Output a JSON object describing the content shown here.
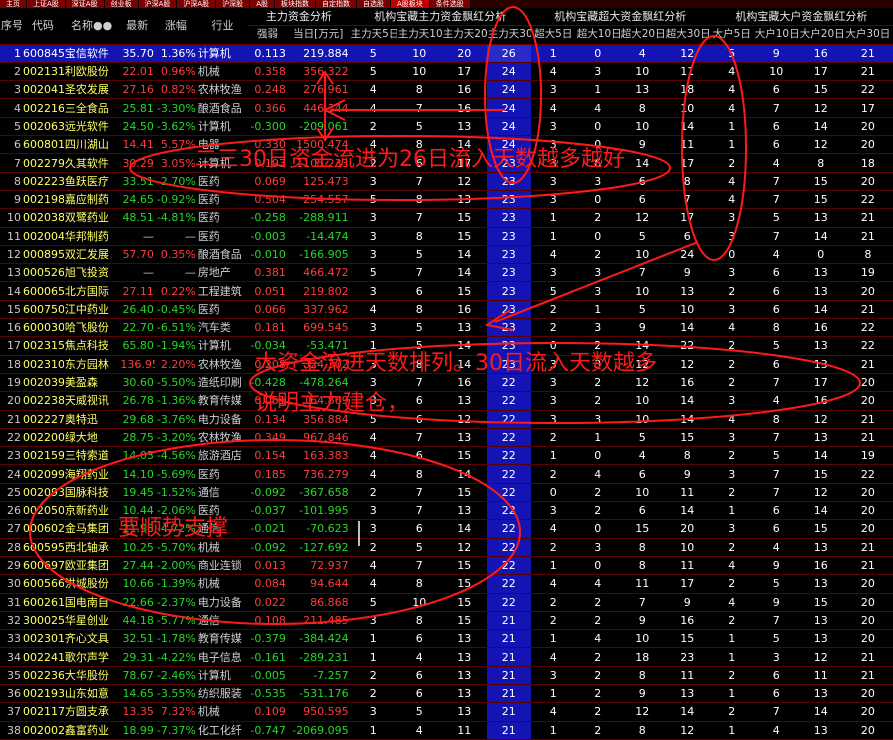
{
  "tabs": [
    "主页",
    "上证A股",
    "深证A股",
    "创业板",
    "沪深A股",
    "沪深A股",
    "沪深股",
    "A股",
    "板块指数",
    "自定指数",
    "自选股",
    "A股板块",
    "条件选股"
  ],
  "headers": {
    "groups": [
      "主力资金分析",
      "机构宝藏主力资金飘红分析",
      "机构宝藏超大资金飘红分析",
      "机构宝藏大户资金飘红分析"
    ],
    "cols": [
      "序号",
      "代码",
      "名称●●",
      "最新",
      "涨幅",
      "行业",
      "强弱",
      "当日[万元]",
      "主力天5日",
      "主力天10日",
      "主力天20日",
      "主力天30日",
      "超大5日",
      "超大10日",
      "超大20日",
      "超大30日",
      "大户5日",
      "大户10日",
      "大户20日",
      "大户30日"
    ]
  },
  "rows": [
    [
      "1",
      "600845",
      "宝信软件",
      "35.70",
      "1.36%",
      "计算机",
      "0.113",
      "219.884",
      "5",
      "10",
      "20",
      "26",
      "1",
      "0",
      "4",
      "12",
      "5",
      "9",
      "16",
      "21"
    ],
    [
      "2",
      "002131",
      "利欧股份",
      "22.01",
      "0.96%",
      "机械",
      "0.358",
      "356.322",
      "5",
      "10",
      "17",
      "24",
      "4",
      "3",
      "10",
      "11",
      "4",
      "10",
      "17",
      "21"
    ],
    [
      "3",
      "002041",
      "圣农发展",
      "27.16",
      "0.82%",
      "农林牧渔",
      "0.248",
      "276.961",
      "4",
      "8",
      "16",
      "24",
      "3",
      "1",
      "13",
      "18",
      "4",
      "6",
      "15",
      "22"
    ],
    [
      "4",
      "002216",
      "三全食品",
      "25.81",
      "-3.30%",
      "酿酒食品",
      "0.366",
      "446.344",
      "4",
      "7",
      "16",
      "24",
      "4",
      "4",
      "8",
      "10",
      "4",
      "7",
      "12",
      "17"
    ],
    [
      "5",
      "002063",
      "远光软件",
      "24.50",
      "-3.62%",
      "计算机",
      "-0.300",
      "-209.061",
      "2",
      "5",
      "13",
      "24",
      "3",
      "0",
      "10",
      "14",
      "1",
      "6",
      "14",
      "20"
    ],
    [
      "6",
      "600801",
      "四川湖山",
      "14.41",
      "5.57%",
      "电器",
      "0.330",
      "1500.474",
      "4",
      "8",
      "14",
      "24",
      "3",
      "0",
      "9",
      "11",
      "1",
      "6",
      "12",
      "20"
    ],
    [
      "7",
      "002279",
      "久其软件",
      "30.29",
      "3.05%",
      "计算机",
      "0.193",
      "1105.233",
      "2",
      "6",
      "17",
      "23",
      "3",
      "6",
      "14",
      "17",
      "2",
      "4",
      "8",
      "18"
    ],
    [
      "8",
      "002223",
      "鱼跃医疗",
      "33.51",
      "-2.70%",
      "医药",
      "0.069",
      "125.473",
      "3",
      "7",
      "12",
      "23",
      "3",
      "3",
      "6",
      "8",
      "4",
      "7",
      "15",
      "20"
    ],
    [
      "9",
      "002198",
      "嘉应制药",
      "24.65",
      "-0.92%",
      "医药",
      "0.504",
      "254.557",
      "5",
      "8",
      "13",
      "23",
      "3",
      "0",
      "6",
      "7",
      "4",
      "7",
      "15",
      "22"
    ],
    [
      "10",
      "002038",
      "双鹭药业",
      "48.51",
      "-4.81%",
      "医药",
      "-0.258",
      "-288.911",
      "3",
      "7",
      "15",
      "23",
      "1",
      "2",
      "12",
      "17",
      "3",
      "5",
      "13",
      "21"
    ],
    [
      "11",
      "002004",
      "华邦制药",
      "—",
      "—",
      "医药",
      "-0.003",
      "-14.474",
      "3",
      "8",
      "15",
      "23",
      "1",
      "0",
      "5",
      "6",
      "3",
      "7",
      "14",
      "21"
    ],
    [
      "12",
      "000895",
      "双汇发展",
      "57.70",
      "0.35%",
      "酿酒食品",
      "-0.010",
      "-166.905",
      "3",
      "5",
      "14",
      "23",
      "4",
      "2",
      "10",
      "24",
      "0",
      "4",
      "0",
      "8"
    ],
    [
      "13",
      "000526",
      "旭飞投资",
      "—",
      "—",
      "房地产",
      "0.381",
      "466.472",
      "5",
      "7",
      "14",
      "23",
      "3",
      "3",
      "7",
      "9",
      "3",
      "6",
      "13",
      "19"
    ],
    [
      "14",
      "600065",
      "北方国际",
      "27.11",
      "0.22%",
      "工程建筑",
      "0.051",
      "219.802",
      "3",
      "6",
      "15",
      "23",
      "5",
      "3",
      "10",
      "13",
      "2",
      "6",
      "13",
      "20"
    ],
    [
      "15",
      "600750",
      "江中药业",
      "26.40",
      "-0.45%",
      "医药",
      "0.066",
      "337.962",
      "4",
      "8",
      "16",
      "23",
      "2",
      "1",
      "5",
      "10",
      "3",
      "6",
      "14",
      "21"
    ],
    [
      "16",
      "600030",
      "哈飞股份",
      "22.70",
      "-6.51%",
      "汽车类",
      "0.181",
      "699.545",
      "3",
      "5",
      "13",
      "23",
      "2",
      "3",
      "9",
      "14",
      "4",
      "8",
      "16",
      "22"
    ],
    [
      "17",
      "002315",
      "焦点科技",
      "65.80",
      "-1.94%",
      "计算机",
      "-0.034",
      "-53.471",
      "1",
      "5",
      "14",
      "23",
      "0",
      "2",
      "14",
      "22",
      "2",
      "5",
      "13",
      "22"
    ],
    [
      "18",
      "002310",
      "东方园林",
      "136.95",
      "2.20%",
      "农林牧渔",
      "0.208",
      "324.302",
      "3",
      "8",
      "14",
      "23",
      "3",
      "3",
      "12",
      "12",
      "2",
      "6",
      "13",
      "21"
    ],
    [
      "19",
      "002039",
      "美盈森",
      "30.60",
      "-5.50%",
      "造纸印刷",
      "-0.428",
      "-478.264",
      "3",
      "7",
      "16",
      "22",
      "3",
      "2",
      "12",
      "16",
      "2",
      "7",
      "17",
      "20"
    ],
    [
      "20",
      "002238",
      "天威视讯",
      "26.78",
      "-1.36%",
      "教育传媒",
      "0.051",
      "164.869",
      "3",
      "6",
      "13",
      "22",
      "3",
      "2",
      "10",
      "14",
      "3",
      "4",
      "16",
      "20"
    ],
    [
      "21",
      "002227",
      "奥特迅",
      "29.68",
      "-3.76%",
      "电力设备",
      "0.134",
      "356.884",
      "5",
      "6",
      "12",
      "22",
      "3",
      "3",
      "10",
      "14",
      "4",
      "8",
      "12",
      "21"
    ],
    [
      "22",
      "002200",
      "绿大地",
      "28.75",
      "-3.20%",
      "农林牧渔",
      "0.349",
      "967.846",
      "4",
      "7",
      "13",
      "22",
      "2",
      "1",
      "5",
      "15",
      "3",
      "7",
      "13",
      "21"
    ],
    [
      "23",
      "002159",
      "三特索道",
      "14.03",
      "-4.56%",
      "旅游酒店",
      "0.154",
      "163.383",
      "4",
      "6",
      "15",
      "22",
      "1",
      "0",
      "4",
      "8",
      "2",
      "5",
      "14",
      "19"
    ],
    [
      "24",
      "002099",
      "海翔药业",
      "14.10",
      "-5.69%",
      "医药",
      "0.185",
      "736.279",
      "4",
      "8",
      "14",
      "22",
      "2",
      "4",
      "6",
      "9",
      "3",
      "7",
      "15",
      "22"
    ],
    [
      "25",
      "002093",
      "国脉科技",
      "19.45",
      "-1.52%",
      "通信",
      "-0.092",
      "-367.658",
      "2",
      "7",
      "15",
      "22",
      "0",
      "2",
      "10",
      "11",
      "2",
      "7",
      "12",
      "20"
    ],
    [
      "26",
      "002050",
      "京新药业",
      "10.44",
      "-2.06%",
      "医药",
      "-0.037",
      "-101.995",
      "3",
      "7",
      "13",
      "22",
      "3",
      "2",
      "6",
      "14",
      "1",
      "6",
      "14",
      "20"
    ],
    [
      "27",
      "000602",
      "金马集团",
      "11.98",
      "-4.72%",
      "通信",
      "-0.021",
      "-70.623",
      "3",
      "6",
      "14",
      "22",
      "4",
      "0",
      "15",
      "20",
      "3",
      "6",
      "15",
      "20"
    ],
    [
      "28",
      "600595",
      "西北轴承",
      "10.25",
      "-5.70%",
      "机械",
      "-0.092",
      "-127.692",
      "2",
      "5",
      "12",
      "22",
      "2",
      "3",
      "8",
      "10",
      "2",
      "4",
      "13",
      "21"
    ],
    [
      "29",
      "600697",
      "欧亚集团",
      "27.44",
      "-2.00%",
      "商业连锁",
      "0.013",
      "72.937",
      "4",
      "7",
      "15",
      "22",
      "1",
      "0",
      "8",
      "11",
      "4",
      "9",
      "16",
      "21"
    ],
    [
      "30",
      "600566",
      "洪城股份",
      "10.66",
      "-1.39%",
      "机械",
      "0.084",
      "94.644",
      "4",
      "8",
      "15",
      "22",
      "4",
      "4",
      "11",
      "17",
      "2",
      "5",
      "13",
      "20"
    ],
    [
      "31",
      "600261",
      "国电南自",
      "22.66",
      "-2.37%",
      "电力设备",
      "0.022",
      "86.868",
      "5",
      "10",
      "15",
      "22",
      "2",
      "2",
      "7",
      "9",
      "4",
      "9",
      "15",
      "20"
    ],
    [
      "32",
      "300025",
      "华星创业",
      "44.18",
      "-5.77%",
      "通信",
      "0.108",
      "211.485",
      "3",
      "8",
      "15",
      "21",
      "2",
      "2",
      "9",
      "16",
      "2",
      "7",
      "13",
      "20"
    ],
    [
      "33",
      "002301",
      "齐心文具",
      "32.51",
      "-1.78%",
      "教育传媒",
      "-0.379",
      "-384.424",
      "1",
      "6",
      "13",
      "21",
      "1",
      "4",
      "10",
      "15",
      "1",
      "5",
      "13",
      "20"
    ],
    [
      "34",
      "002241",
      "歌尔声学",
      "29.31",
      "-4.22%",
      "电子信息",
      "-0.161",
      "-289.231",
      "1",
      "4",
      "13",
      "21",
      "4",
      "2",
      "18",
      "23",
      "1",
      "3",
      "12",
      "21"
    ],
    [
      "35",
      "002236",
      "大华股份",
      "78.67",
      "-2.46%",
      "计算机",
      "-0.005",
      "-7.257",
      "2",
      "6",
      "13",
      "21",
      "3",
      "2",
      "8",
      "11",
      "2",
      "6",
      "11",
      "21"
    ],
    [
      "36",
      "002193",
      "山东如意",
      "14.65",
      "-3.55%",
      "纺织服装",
      "-0.535",
      "-531.176",
      "2",
      "6",
      "13",
      "21",
      "1",
      "2",
      "9",
      "13",
      "1",
      "6",
      "13",
      "20"
    ],
    [
      "37",
      "002117",
      "方圆支承",
      "13.35",
      "7.32%",
      "机械",
      "0.109",
      "950.595",
      "3",
      "5",
      "13",
      "21",
      "4",
      "2",
      "12",
      "14",
      "2",
      "7",
      "14",
      "20"
    ],
    [
      "38",
      "002002",
      "鑫富药业",
      "18.99",
      "-7.37%",
      "化工化纤",
      "-0.747",
      "-2069.095",
      "1",
      "4",
      "11",
      "21",
      "1",
      "2",
      "8",
      "12",
      "1",
      "4",
      "13",
      "20"
    ]
  ],
  "annotations": {
    "a1": "二三30日资金流进为26日流入天数越多越好",
    "a2": "大资金流进天数排列。30日流入天数越多",
    "a3": "说明主力建仓，",
    "a4": "需要",
    "a5": "要顺势支撑"
  },
  "colors": {
    "up": "#ff3c3c",
    "down": "#28d628",
    "highlight": "#1414b4",
    "marker": "#ff1a1a"
  }
}
